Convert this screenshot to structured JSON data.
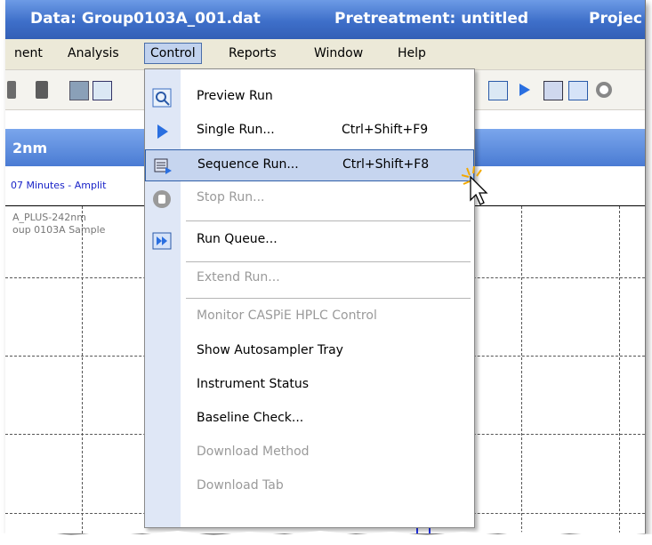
{
  "titlebar": {
    "data": "Data: Group0103A_001.dat",
    "pretreatment": "Pretreatment: untitled",
    "project": "Projec"
  },
  "menubar": {
    "items": [
      {
        "label": "nent"
      },
      {
        "label": "Analysis"
      },
      {
        "label": "Control"
      },
      {
        "label": "Reports"
      },
      {
        "label": "Window"
      },
      {
        "label": "Help"
      }
    ]
  },
  "panel": {
    "title": "2nm",
    "subtitle": "07 Minutes - Amplit",
    "legend1": "A_PLUS-242nm",
    "legend2": "oup 0103A Sample"
  },
  "control_menu": {
    "items": [
      {
        "label": "Preview Run",
        "shortcut": "",
        "icon": "magnifier-icon"
      },
      {
        "label": "Single Run...",
        "shortcut": "Ctrl+Shift+F9",
        "icon": "play-icon"
      },
      {
        "label": "Sequence Run...",
        "shortcut": "Ctrl+Shift+F8",
        "icon": "sequence-icon"
      },
      {
        "label": "Stop Run...",
        "shortcut": "",
        "icon": "hand-icon"
      },
      {
        "label": "Run Queue...",
        "shortcut": "",
        "icon": "queue-icon"
      },
      {
        "label": "Extend Run...",
        "shortcut": ""
      },
      {
        "label": "Monitor CASPiE HPLC Control",
        "shortcut": ""
      },
      {
        "label": "Show Autosampler Tray",
        "shortcut": ""
      },
      {
        "label": "Instrument Status",
        "shortcut": ""
      },
      {
        "label": "Baseline Check...",
        "shortcut": ""
      },
      {
        "label": "Download Method",
        "shortcut": ""
      },
      {
        "label": "Download Tab",
        "shortcut": ""
      }
    ]
  }
}
